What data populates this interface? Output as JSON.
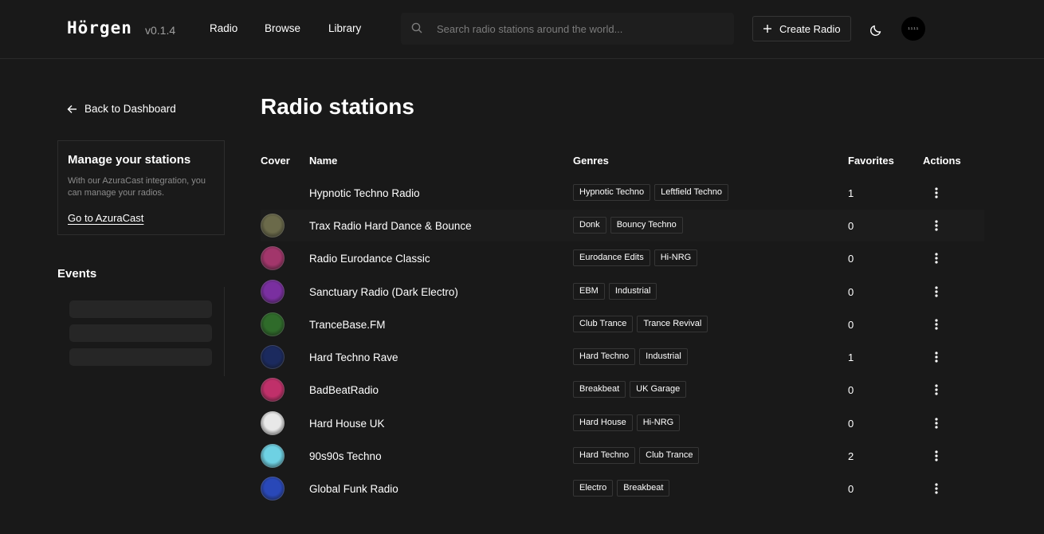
{
  "header": {
    "logo": "Hörgen",
    "version": "v0.1.4",
    "nav": [
      "Radio",
      "Browse",
      "Library"
    ],
    "search_placeholder": "Search radio stations around the world...",
    "create_label": "Create Radio",
    "avatar_text": "ıııı"
  },
  "sidebar": {
    "back_label": "Back to Dashboard",
    "manage_title": "Manage your stations",
    "manage_desc": "With our AzuraCast integration, you can manage your radios.",
    "manage_link": "Go to AzuraCast",
    "events_title": "Events"
  },
  "main": {
    "title": "Radio stations",
    "columns": {
      "cover": "Cover",
      "name": "Name",
      "genres": "Genres",
      "favorites": "Favorites",
      "actions": "Actions"
    },
    "rows": [
      {
        "name": "Hypnotic Techno Radio",
        "genres": [
          "Hypnotic Techno",
          "Leftfield Techno"
        ],
        "favorites": "1",
        "cover": "none"
      },
      {
        "name": "Trax Radio Hard Dance & Bounce",
        "genres": [
          "Donk",
          "Bouncy Techno"
        ],
        "favorites": "0",
        "cover": "#6b6a4a"
      },
      {
        "name": "Radio Eurodance Classic",
        "genres": [
          "Eurodance Edits",
          "Hi-NRG"
        ],
        "favorites": "0",
        "cover": "#a2366b"
      },
      {
        "name": "Sanctuary Radio (Dark Electro)",
        "genres": [
          "EBM",
          "Industrial"
        ],
        "favorites": "0",
        "cover": "#7a2fa0"
      },
      {
        "name": "TranceBase.FM",
        "genres": [
          "Club Trance",
          "Trance Revival"
        ],
        "favorites": "0",
        "cover": "#2f6b2a"
      },
      {
        "name": "Hard Techno Rave",
        "genres": [
          "Hard Techno",
          "Industrial"
        ],
        "favorites": "1",
        "cover": "#1b2a5e"
      },
      {
        "name": "BadBeatRadio",
        "genres": [
          "Breakbeat",
          "UK Garage"
        ],
        "favorites": "0",
        "cover": "#c0306a"
      },
      {
        "name": "Hard House UK",
        "genres": [
          "Hard House",
          "Hi-NRG"
        ],
        "favorites": "0",
        "cover": "#e8e8e8"
      },
      {
        "name": "90s90s Techno",
        "genres": [
          "Hard Techno",
          "Club Trance"
        ],
        "favorites": "2",
        "cover": "#6ed1e3"
      },
      {
        "name": "Global Funk Radio",
        "genres": [
          "Electro",
          "Breakbeat"
        ],
        "favorites": "0",
        "cover": "#2948b8"
      }
    ]
  }
}
